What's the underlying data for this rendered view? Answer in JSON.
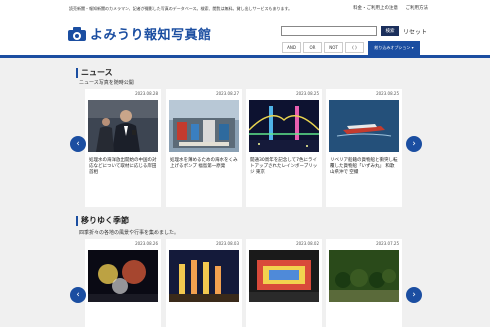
{
  "header": {
    "tagline": "読売新聞・報知新聞のカメラマン、記者が撮影した写真のデータベース。検索、閲覧は無料。貸し出しサービスもあります。",
    "links": [
      "料金・ご利用上の注意",
      "ご利用方法"
    ],
    "logo_text": "よみうり報知写真館",
    "search_value": "",
    "search_button": "検索",
    "reset_label": "リセット",
    "operators": [
      "AND",
      "OR",
      "NOT",
      "( )"
    ],
    "narrow_button": "絞り込みオプション ▾"
  },
  "news": {
    "title": "ニュース",
    "desc": "ニュース写真を随時公開",
    "cards": [
      {
        "date": "2023.08.28",
        "caption": "処理水の海洋放出開始の中国の対応などについて取材に応じる岸田首相"
      },
      {
        "date": "2023.08.27",
        "caption": "処理水を薄めるための海水をくみ上げるポンプ 福島第一原発"
      },
      {
        "date": "2023.08.25",
        "caption": "開通30周年を記念して7色にライトアップされたレインボーブリッジ 東京"
      },
      {
        "date": "2023.08.25",
        "caption": "リベリア船籍の貨物船と衝突し転覆した貨物船「いずみ丸」 和歌山県沖で 空撮"
      }
    ]
  },
  "seasons": {
    "title": "移りゆく季節",
    "desc": "四季折々の各地の風景や行事を集めました。",
    "cards": [
      {
        "date": "2023.08.26",
        "caption": ""
      },
      {
        "date": "2023.08.03",
        "caption": ""
      },
      {
        "date": "2023.08.02",
        "caption": ""
      },
      {
        "date": "2023.07.25",
        "caption": ""
      }
    ]
  },
  "nav": {
    "prev": "‹",
    "next": "›"
  },
  "colors": {
    "brand": "#1b4ea1",
    "background": "#f0f0f0"
  }
}
